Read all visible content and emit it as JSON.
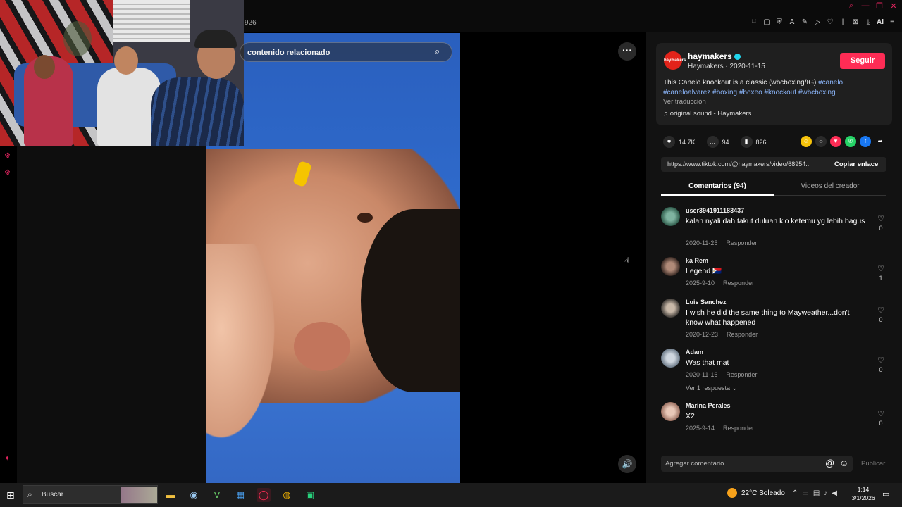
{
  "browser": {
    "url_fragment": "926",
    "ext_ai_label": "AI"
  },
  "video": {
    "search_placeholder": "contenido relacionado"
  },
  "post": {
    "avatar_text": "haymakers",
    "author": "haymakers",
    "subline": "Haymakers · 2020-11-15",
    "follow_label": "Seguir",
    "caption_text": "This Canelo knockout is a classic (wbcboxing/IG) ",
    "hashtags": [
      "#canelo",
      "#caneloalvarez",
      "#boxing",
      "#boxeo",
      "#knockout",
      "#wbcboxing"
    ],
    "translate_label": "Ver traducción",
    "sound": "original sound - Haymakers",
    "likes": "14.7K",
    "comments": "94",
    "saves": "826",
    "link": "https://www.tiktok.com/@haymakers/video/68954...",
    "copy_label": "Copiar enlace"
  },
  "tabs": {
    "comments": "Comentarios (94)",
    "creator_videos": "Videos del creador"
  },
  "comments": [
    {
      "user": "user3941911183437",
      "text": "kalah nyali dah takut duluan klo ketemu yg lebih bagus",
      "date": "2020-11-25",
      "reply": "Responder",
      "likes": "0"
    },
    {
      "user": "ka Rem",
      "text": "Legend 🇸🇽",
      "date": "2025-9-10",
      "reply": "Responder",
      "likes": "1"
    },
    {
      "user": "Luis Sanchez",
      "text": "I wish he did the same thing to Mayweather...don't know what happened",
      "date": "2020-12-23",
      "reply": "Responder",
      "likes": "0"
    },
    {
      "user": "Adam",
      "text": "Was that mat",
      "date": "2020-11-16",
      "reply": "Responder",
      "likes": "0",
      "replies": "Ver 1 respuesta ⌄"
    },
    {
      "user": "Marina Perales",
      "text": "X2",
      "date": "2025-9-14",
      "reply": "Responder",
      "likes": "0"
    }
  ],
  "composer": {
    "placeholder": "Agregar comentario...",
    "publish": "Publicar"
  },
  "taskbar": {
    "search_label": "Buscar",
    "weather": "22°C Soleado",
    "time": "1:14",
    "date": "3/1/2026"
  },
  "colors": {
    "accent": "#fe2c55",
    "hashtag": "#8ab4f8",
    "panel": "#121212"
  }
}
